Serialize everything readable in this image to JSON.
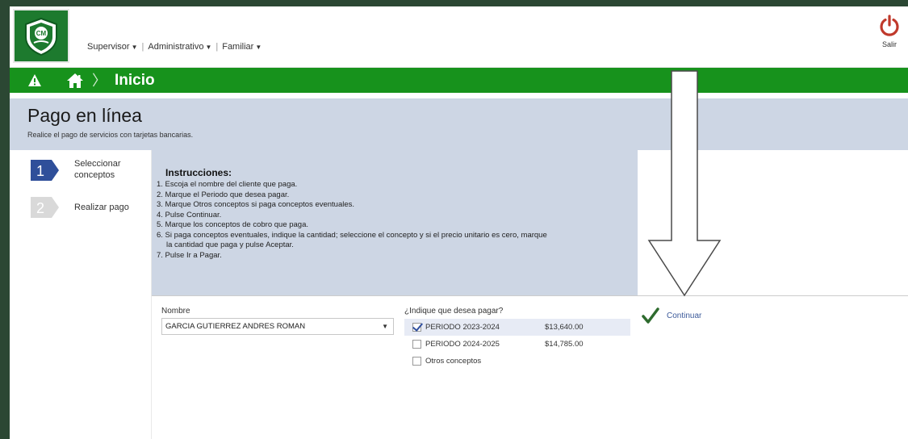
{
  "header": {
    "logo_text": "CM",
    "nav": [
      {
        "label": "Supervisor"
      },
      {
        "label": "Administrativo"
      },
      {
        "label": "Familiar"
      }
    ],
    "logout_label": "Salir"
  },
  "breadcrumb": {
    "title": "Inicio"
  },
  "page": {
    "title": "Pago en línea",
    "subtitle": "Realice el pago de servicios con tarjetas bancarias."
  },
  "steps": [
    {
      "number": "1",
      "label": "Seleccionar conceptos",
      "active": true
    },
    {
      "number": "2",
      "label": "Realizar pago",
      "active": false
    }
  ],
  "instructions": {
    "title": "Instrucciones:",
    "lines": [
      "1. Escoja el nombre del cliente que paga.",
      "2. Marque el Periodo que desea pagar.",
      "3. Marque Otros conceptos si paga conceptos eventuales.",
      "4. Pulse Continuar.",
      "5. Marque los conceptos de cobro que paga.",
      "6. Si paga conceptos eventuales, indique la cantidad; seleccione el concepto y si el precio unitario es cero, marque",
      "la cantidad que paga y pulse Aceptar.",
      "7. Pulse Ir a Pagar."
    ]
  },
  "form": {
    "name_label": "Nombre",
    "name_value": "GARCIA GUTIERREZ ANDRES ROMAN",
    "pay_label": "¿Indique que desea pagar?",
    "options": [
      {
        "label": "PERIODO 2023-2024",
        "amount": "$13,640.00",
        "checked": true
      },
      {
        "label": "PERIODO 2024-2025",
        "amount": "$14,785.00",
        "checked": false
      },
      {
        "label": "Otros conceptos",
        "amount": "",
        "checked": false
      }
    ],
    "continue_label": "Continuar"
  },
  "colors": {
    "green_bar": "#17921c",
    "band": "#cdd6e4",
    "step_active": "#2f4f9a",
    "step_inactive": "#d9d9d9",
    "logout": "#c0392b",
    "check_green": "#2e6b2e"
  }
}
